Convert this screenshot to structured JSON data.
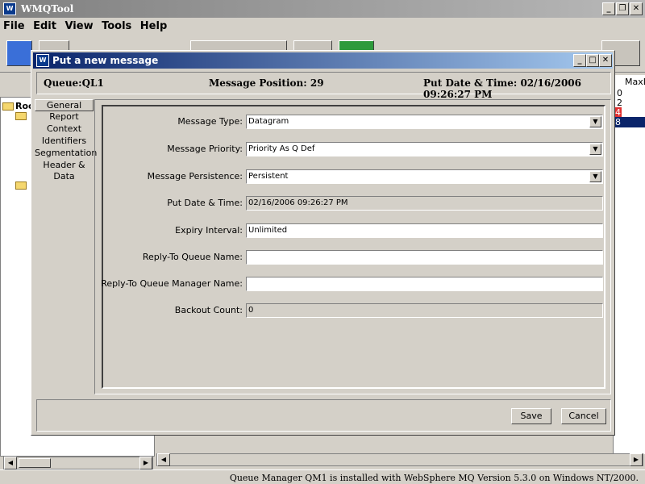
{
  "app": {
    "title": "WMQTool"
  },
  "menu": [
    "File",
    "Edit",
    "View",
    "Tools",
    "Help"
  ],
  "tree": {
    "root_label": "Roo"
  },
  "list_pane": {
    "header": "MaxD",
    "cells": [
      "0",
      "2",
      "4",
      "8"
    ]
  },
  "statusbar": {
    "text": "Queue Manager QM1  is installed with WebSphere MQ Version 5.3.0 on Windows NT/2000."
  },
  "dialog": {
    "title": "Put a new message",
    "info": {
      "queue": "Queue:QL1",
      "position": "Message Position: 29",
      "put_datetime": "Put Date & Time: 02/16/2006 09:26:27 PM"
    },
    "tabs": [
      "General",
      "Report",
      "Context",
      "Identifiers",
      "Segmentation",
      "Header & Data"
    ],
    "active_tab": "General",
    "fields": {
      "message_type": {
        "label": "Message Type:",
        "value": "Datagram"
      },
      "message_priority": {
        "label": "Message Priority:",
        "value": "Priority As Q Def"
      },
      "message_persistence": {
        "label": "Message Persistence:",
        "value": "Persistent"
      },
      "put_date_time": {
        "label": "Put Date & Time:",
        "value": "02/16/2006 09:26:27 PM"
      },
      "expiry_interval": {
        "label": "Expiry Interval:",
        "value": "Unlimited"
      },
      "reply_to_queue": {
        "label": "Reply-To Queue Name:",
        "value": ""
      },
      "reply_to_qmgr": {
        "label": "Reply-To Queue Manager Name:",
        "value": ""
      },
      "backout_count": {
        "label": "Backout Count:",
        "value": "0"
      }
    },
    "buttons": {
      "save": "Save",
      "cancel": "Cancel"
    }
  },
  "icons": {
    "minimize": "_",
    "maximize": "□",
    "restore": "❐",
    "close": "✕",
    "dropdown": "▼",
    "left": "◀",
    "right": "▶"
  },
  "colors": {
    "title_active": "#0a246a",
    "title_inactive": "#808080",
    "selection": "#0a246a",
    "alert": "#e03030"
  }
}
